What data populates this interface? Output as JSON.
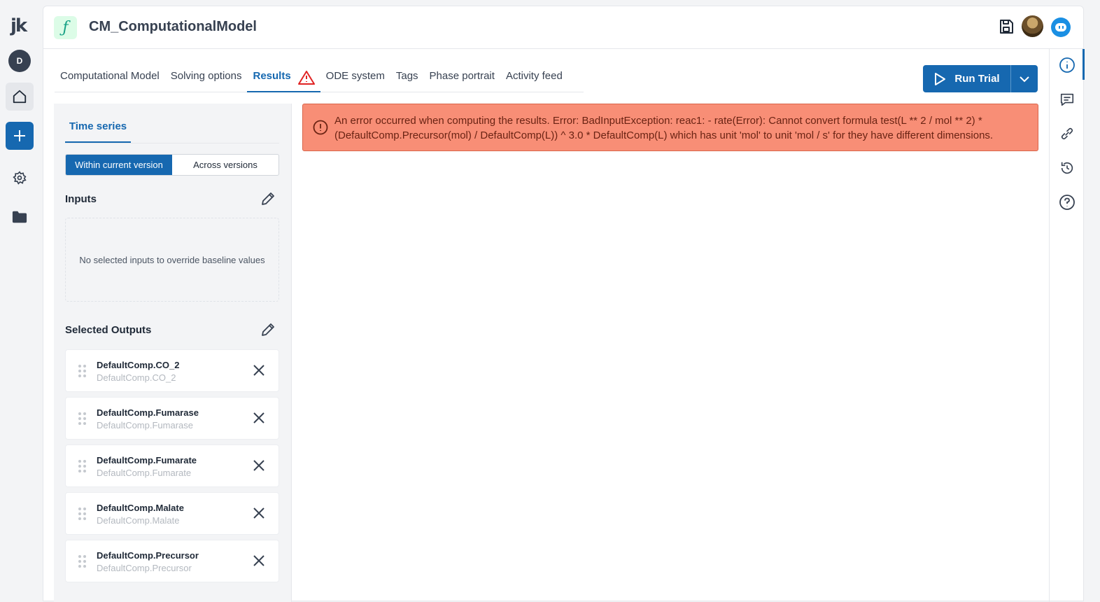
{
  "rail": {
    "logo": "jk",
    "avatar_initial": "D",
    "icons": [
      "home-icon",
      "plus-icon",
      "gear-icon",
      "folder-icon"
    ]
  },
  "header": {
    "model_icon": "ƒ",
    "title": "CM_ComputationalModel",
    "icons": [
      "save-icon",
      "user-avatar",
      "assistant-bot-icon"
    ]
  },
  "tabs": [
    {
      "label": "Computational Model",
      "active": false
    },
    {
      "label": "Solving options",
      "active": false
    },
    {
      "label": "Results",
      "active": true,
      "warning": true
    },
    {
      "label": "ODE system",
      "active": false
    },
    {
      "label": "Tags",
      "active": false
    },
    {
      "label": "Phase portrait",
      "active": false
    },
    {
      "label": "Activity feed",
      "active": false
    }
  ],
  "run": {
    "label": "Run Trial"
  },
  "sidebar": {
    "tab_label": "Time series",
    "toggle": {
      "within": "Within current version",
      "across": "Across versions",
      "selected": "within"
    },
    "inputs_title": "Inputs",
    "inputs_empty": "No selected inputs to override baseline values",
    "outputs_title": "Selected Outputs",
    "outputs": [
      {
        "name": "DefaultComp.CO_2",
        "sub": "DefaultComp.CO_2"
      },
      {
        "name": "DefaultComp.Fumarase",
        "sub": "DefaultComp.Fumarase"
      },
      {
        "name": "DefaultComp.Fumarate",
        "sub": "DefaultComp.Fumarate"
      },
      {
        "name": "DefaultComp.Malate",
        "sub": "DefaultComp.Malate"
      },
      {
        "name": "DefaultComp.Precursor",
        "sub": "DefaultComp.Precursor"
      }
    ]
  },
  "error": {
    "message": "An error occurred when computing the results. Error: BadInputException: reac1: - rate(Error): Cannot convert formula test(L ** 2 / mol ** 2) * (DefaultComp.Precursor(mol) / DefaultComp(L)) ^ 3.0 * DefaultComp(L) which has unit 'mol' to unit 'mol / s' for they have different dimensions."
  },
  "right_panel": {
    "icons": [
      "info-icon",
      "comment-icon",
      "link-icon",
      "history-icon",
      "help-icon"
    ],
    "active": "info-icon"
  },
  "colors": {
    "primary": "#1668b0",
    "error_bg": "#f88e76",
    "error_text": "#6a2313",
    "warning": "#e02424"
  }
}
